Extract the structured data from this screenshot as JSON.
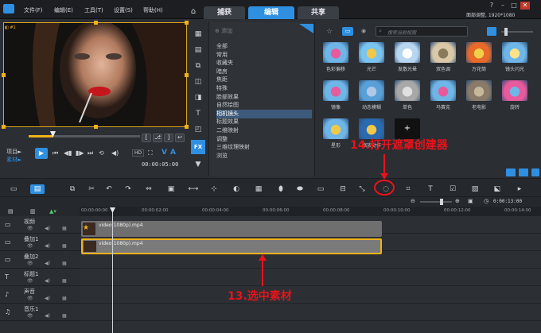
{
  "menu": {
    "file": "文件(F)",
    "edit": "编辑(E)",
    "tools": "工具(T)",
    "settings": "设置(S)",
    "help": "帮助(H)"
  },
  "tabs": {
    "capture": "捕获",
    "edit": "编辑",
    "share": "共享"
  },
  "project_info": "面部调整, 1920*1080",
  "preview": {
    "label": "项目►",
    "clip": "素材►",
    "timecode": "00:00:05:00",
    "zoom_label": "HD"
  },
  "library": {
    "add": "添加",
    "search_placeholder": "搜索当前视图",
    "categories": [
      "全部",
      "常用",
      "收藏夹",
      "暗房",
      "焦距",
      "特殊",
      "脸部效果",
      "自然绘图",
      "相机镜头",
      "标题效果",
      "二维映射",
      "调整",
      "三维纹理映射",
      "浏览"
    ],
    "selected_category": "相机镜头",
    "effects": [
      "色彩偏移",
      "光芒",
      "发散光晕",
      "双色调",
      "万花筒",
      "镜头闪光",
      "镜像",
      "动态模糊",
      "单色",
      "马赛克",
      "老电影",
      "旋转",
      "星形",
      "缩放动作"
    ]
  },
  "timeline": {
    "ruler": [
      "00:00:00:00",
      "00:00:02:00",
      "00:00:04:00",
      "00:00:06:00",
      "00:00:08:00",
      "00:00:10:00",
      "00:00:12:00",
      "00:00:14:00"
    ],
    "zoom_time": "0:00:13:00",
    "tracks": [
      "视频",
      "叠加1",
      "叠加2",
      "标题1",
      "声音",
      "音乐1"
    ],
    "clip1": "video(1080p).mp4",
    "clip2": "video(1080p).mp4"
  },
  "annotations": {
    "step14": "14.打开遮罩创建器",
    "step13": "13.选中素材"
  },
  "colors": {
    "accent": "#2f8fe0",
    "annotation": "#e8131b",
    "selection": "#f0b21a"
  }
}
